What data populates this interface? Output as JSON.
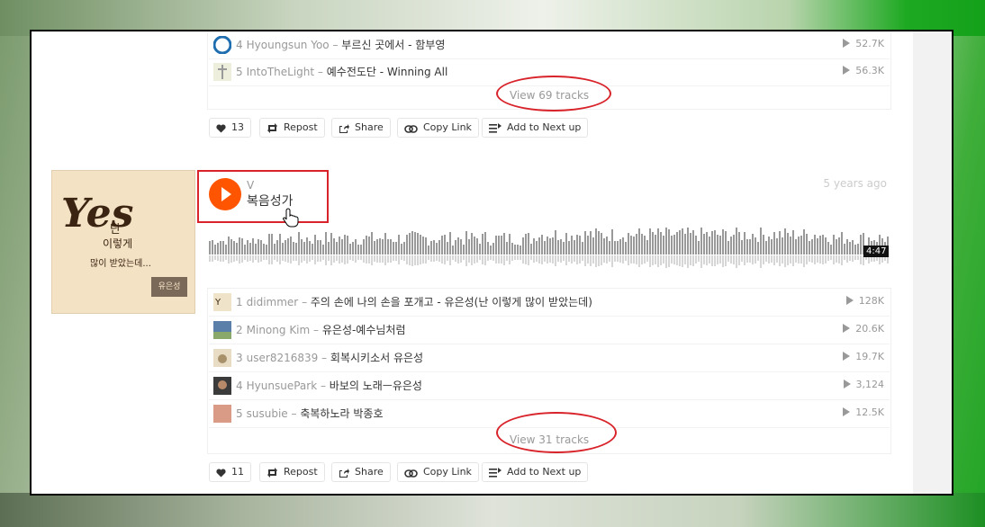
{
  "playlist1": {
    "tracks": [
      {
        "num": "4",
        "user": "Hyoungsun Yoo",
        "title": "부르신 곳에서 - 함부영",
        "plays": "52.7K",
        "thumb_color": "#1f6fb0"
      },
      {
        "num": "5",
        "user": "IntoTheLight",
        "title": "예수전도단 - Winning All",
        "plays": "56.3K",
        "thumb_color": "#d9d9c0"
      }
    ],
    "view_tracks": "View 69 tracks",
    "like_count": "13",
    "actions": {
      "repost": "Repost",
      "share": "Share",
      "copy_link": "Copy Link",
      "add_next": "Add to Next up"
    }
  },
  "playlist2": {
    "user": "V",
    "title": "복음성가",
    "time_ago": "5 years ago",
    "duration": "4:47",
    "tracks": [
      {
        "num": "1",
        "user": "didimmer",
        "title": "주의 손에 나의 손을 포개고 - 유은성(난 이렇게 많이 받았는데)",
        "plays": "128K",
        "thumb_color": "#efe3c9"
      },
      {
        "num": "2",
        "user": "Minong Kim",
        "title": "유은성-예수님처럼",
        "plays": "20.6K",
        "thumb_color": "#5a7fa8"
      },
      {
        "num": "3",
        "user": "user8216839",
        "title": "회복시키소서 유은성",
        "plays": "19.7K",
        "thumb_color": "#cbb89a"
      },
      {
        "num": "4",
        "user": "HyunsuePark",
        "title": "바보의 노래ㅡ유은성",
        "plays": "3,124",
        "thumb_color": "#3b3b3b"
      },
      {
        "num": "5",
        "user": "susubie",
        "title": "축복하노라 박종호",
        "plays": "12.5K",
        "thumb_color": "#d99a86"
      }
    ],
    "view_tracks": "View 31 tracks",
    "like_count": "11",
    "actions": {
      "repost": "Repost",
      "share": "Share",
      "copy_link": "Copy Link",
      "add_next": "Add to Next up"
    }
  },
  "artwork": {
    "big": "Yes",
    "line1": "난",
    "line2": "이렇게",
    "line3": "많이 받았는데...",
    "stamp": "유은성"
  },
  "colors": {
    "accent": "#ff5500",
    "annotation": "#d8232a"
  }
}
